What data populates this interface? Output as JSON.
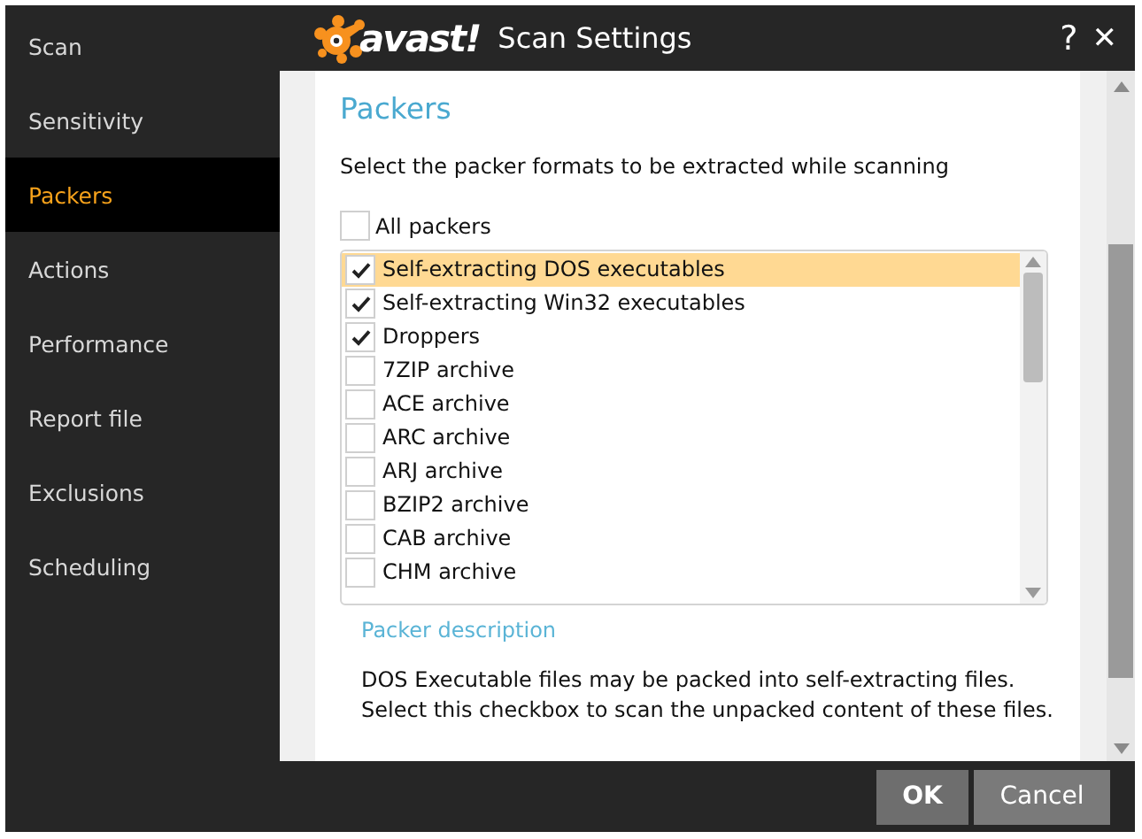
{
  "sidebar": {
    "items": [
      {
        "label": "Scan",
        "selected": false
      },
      {
        "label": "Sensitivity",
        "selected": false
      },
      {
        "label": "Packers",
        "selected": true
      },
      {
        "label": "Actions",
        "selected": false
      },
      {
        "label": "Performance",
        "selected": false
      },
      {
        "label": "Report file",
        "selected": false
      },
      {
        "label": "Exclusions",
        "selected": false
      },
      {
        "label": "Scheduling",
        "selected": false
      }
    ]
  },
  "title_bar": {
    "logo_text": "avast!",
    "title": "Scan Settings",
    "help": "?",
    "close": "✕"
  },
  "section": {
    "heading": "Packers",
    "instruction": "Select the packer formats to be extracted while scanning",
    "all_packers": {
      "label": "All packers",
      "checked": false
    },
    "packers": [
      {
        "label": "Self-extracting DOS executables",
        "checked": true,
        "selected": true
      },
      {
        "label": "Self-extracting Win32 executables",
        "checked": true,
        "selected": false
      },
      {
        "label": "Droppers",
        "checked": true,
        "selected": false
      },
      {
        "label": "7ZIP archive",
        "checked": false,
        "selected": false
      },
      {
        "label": "ACE archive",
        "checked": false,
        "selected": false
      },
      {
        "label": "ARC archive",
        "checked": false,
        "selected": false
      },
      {
        "label": "ARJ archive",
        "checked": false,
        "selected": false
      },
      {
        "label": "BZIP2 archive",
        "checked": false,
        "selected": false
      },
      {
        "label": "CAB archive",
        "checked": false,
        "selected": false
      },
      {
        "label": "CHM archive",
        "checked": false,
        "selected": false
      }
    ],
    "link": "Packer description",
    "description": [
      "DOS Executable files may be packed into self-extracting files.",
      "Select this checkbox to scan the unpacked content of these files."
    ]
  },
  "buttons": [
    {
      "label": "OK",
      "kind": "primary"
    },
    {
      "label": "Cancel",
      "kind": "secondary"
    }
  ]
}
